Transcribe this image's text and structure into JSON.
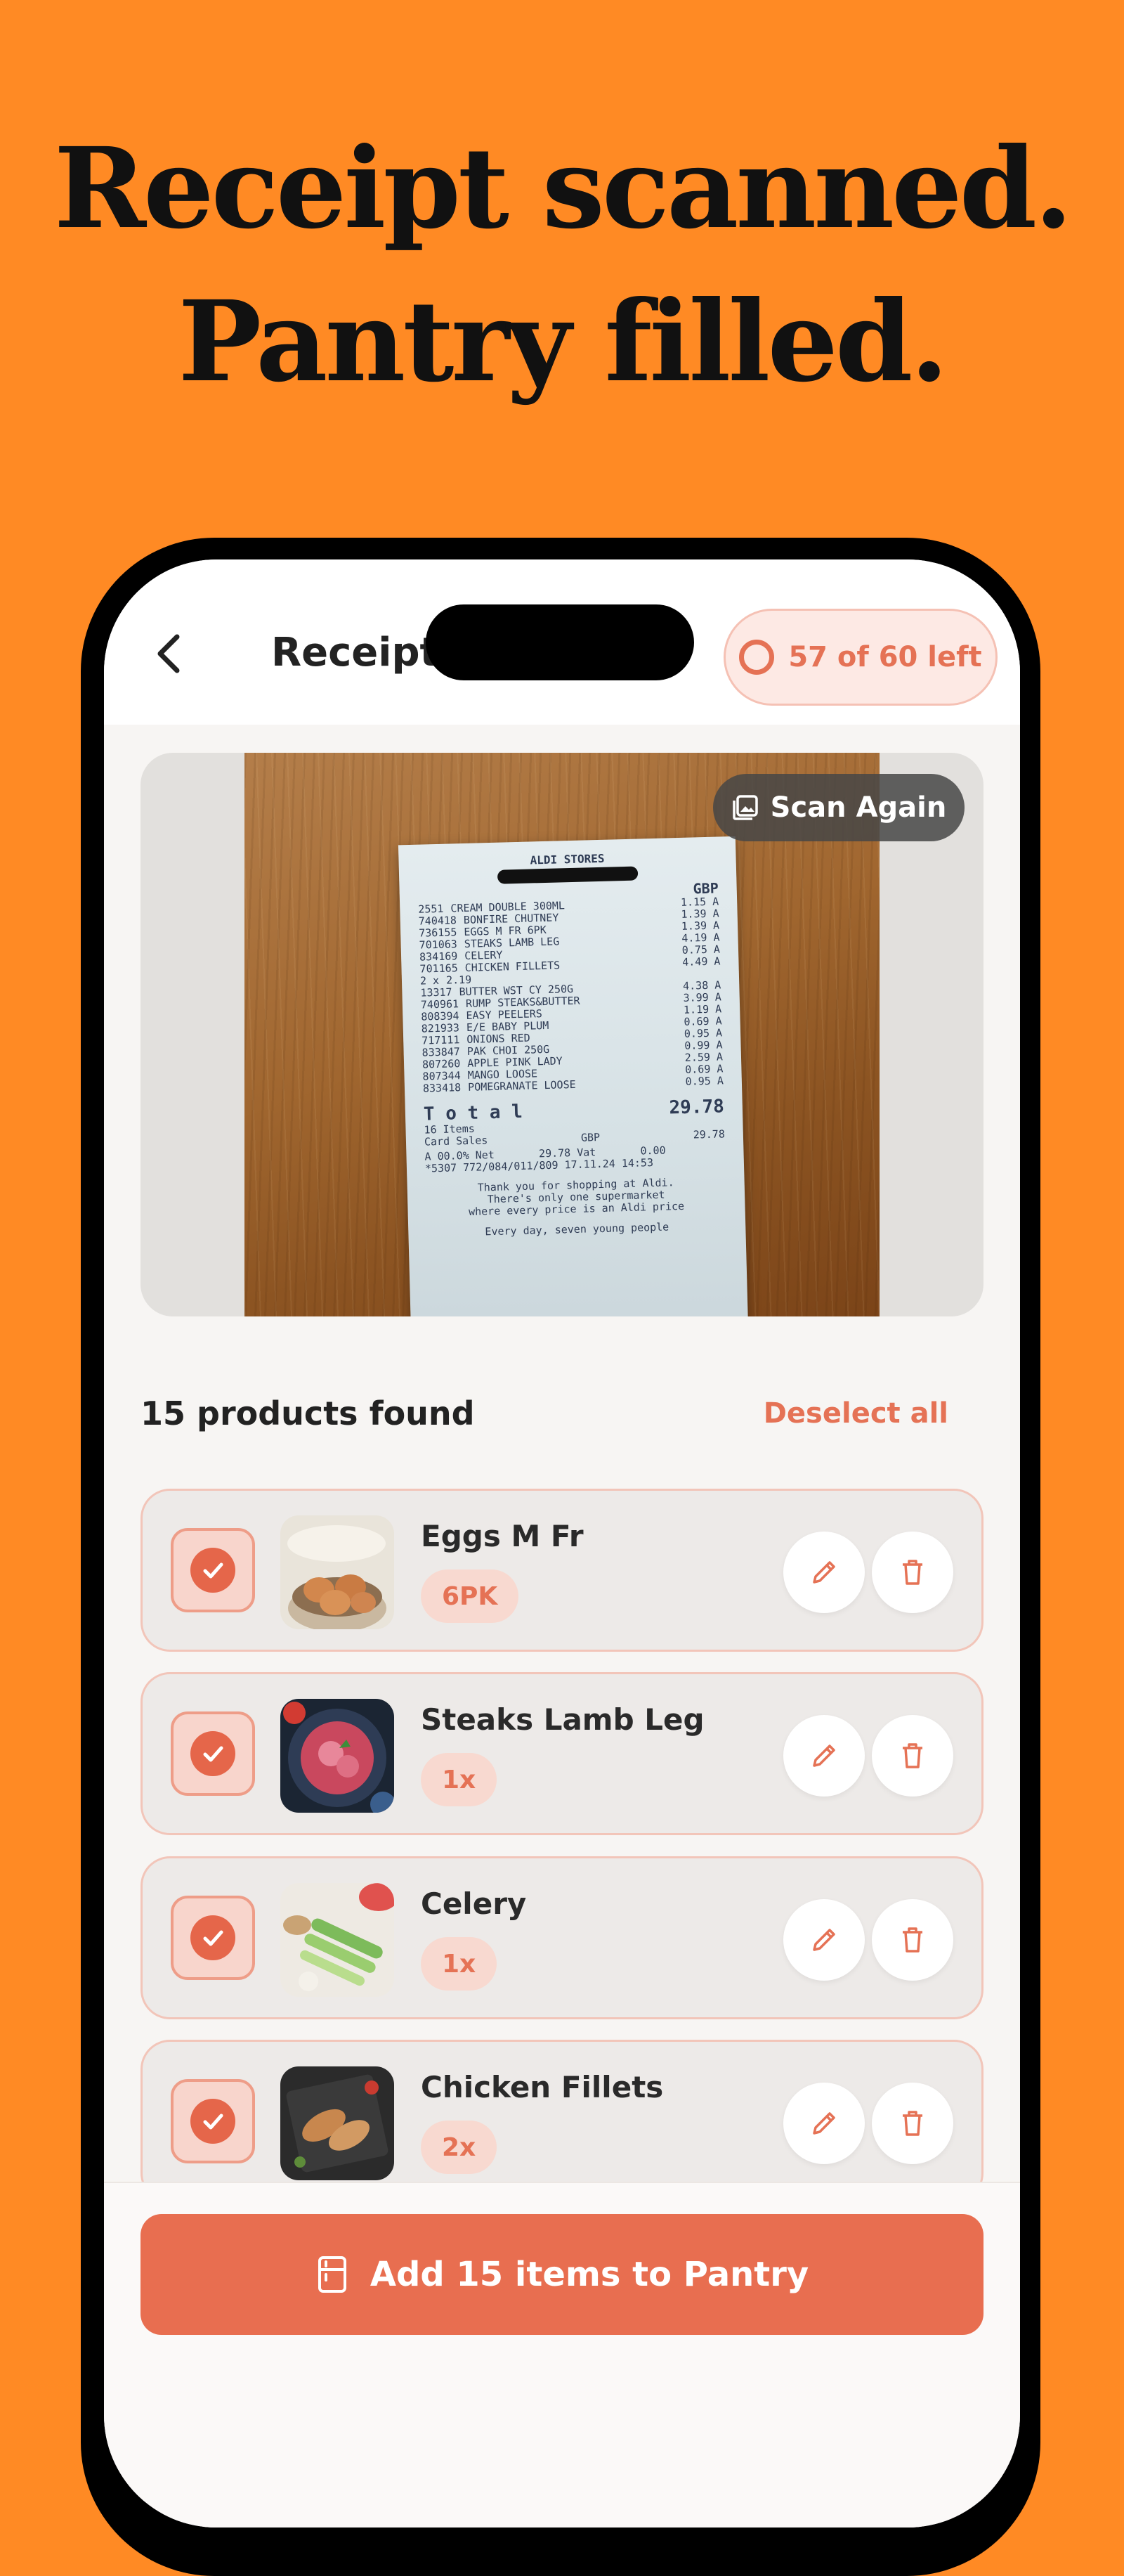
{
  "headline": {
    "line1": "Receipt scanned.",
    "line2": "Pantry filled."
  },
  "header": {
    "title": "Receipt S",
    "scans_left": "57 of 60 left",
    "back_icon": "chevron-left-icon",
    "counter_icon": "progress-ring-icon"
  },
  "receipt": {
    "scan_again_label": "Scan Again",
    "scan_again_icon": "image-icon",
    "paper": {
      "store": "ALDI STORES",
      "currency": "GBP",
      "lines": [
        {
          "code": "2551",
          "desc": "CREAM DOUBLE 300ML",
          "price": "1.15 A"
        },
        {
          "code": "740418",
          "desc": "BONFIRE CHUTNEY",
          "price": "1.39 A"
        },
        {
          "code": "736155",
          "desc": "EGGS M FR 6PK",
          "price": "1.39 A"
        },
        {
          "code": "701063",
          "desc": "STEAKS LAMB LEG",
          "price": "4.19 A"
        },
        {
          "code": "834169",
          "desc": "CELERY",
          "price": "0.75 A"
        },
        {
          "code": "701165",
          "desc": "CHICKEN FILLETS",
          "price": "4.49 A"
        },
        {
          "code": "2 x",
          "desc": "2.19",
          "price": ""
        },
        {
          "code": "13317",
          "desc": "BUTTER WST CY 250G",
          "price": "4.38 A"
        },
        {
          "code": "740961",
          "desc": "RUMP STEAKS&BUTTER",
          "price": "3.99 A"
        },
        {
          "code": "808394",
          "desc": "EASY PEELERS",
          "price": "1.19 A"
        },
        {
          "code": "821933",
          "desc": "E/E BABY PLUM",
          "price": "0.69 A"
        },
        {
          "code": "717111",
          "desc": "ONIONS RED",
          "price": "0.95 A"
        },
        {
          "code": "833847",
          "desc": "PAK CHOI 250G",
          "price": "0.99 A"
        },
        {
          "code": "807260",
          "desc": "APPLE PINK LADY",
          "price": "2.59 A"
        },
        {
          "code": "807344",
          "desc": "MANGO LOOSE",
          "price": "0.69 A"
        },
        {
          "code": "833418",
          "desc": "POMEGRANATE LOOSE",
          "price": "0.95 A"
        }
      ],
      "total_label": "T o t a l",
      "total_value": "29.78",
      "items_count": "16 Items",
      "card_sales_label": "Card Sales",
      "card_sales_currency": "GBP",
      "card_sales_value": "29.78",
      "vat_line": "A 00.0% Net       29.78 Vat       0.00",
      "ref_line": "*5307 772/084/011/809 17.11.24 14:53",
      "thanks_1": "Thank you for shopping at Aldi.",
      "thanks_2": "There's only one supermarket",
      "thanks_3": "where every price is an Aldi price",
      "footer": "Every day, seven young people"
    }
  },
  "results": {
    "count_label": "15 products found",
    "deselect_label": "Deselect all"
  },
  "products": [
    {
      "name": "Eggs M Fr",
      "qty": "6PK",
      "thumb_icon": "eggs-photo"
    },
    {
      "name": "Steaks Lamb Leg",
      "qty": "1x",
      "thumb_icon": "lamb-steak-photo"
    },
    {
      "name": "Celery",
      "qty": "1x",
      "thumb_icon": "celery-photo"
    },
    {
      "name": "Chicken Fillets",
      "qty": "2x",
      "thumb_icon": "chicken-fillets-photo"
    }
  ],
  "actions": {
    "edit_icon": "pencil-icon",
    "delete_icon": "trash-icon",
    "check_icon": "check-icon"
  },
  "footer": {
    "add_button_label": "Add 15 items to Pantry",
    "add_button_icon": "fridge-icon"
  },
  "colors": {
    "background": "#FF8A24",
    "accent": "#E86E50",
    "accent_light": "#F8D9D0"
  }
}
